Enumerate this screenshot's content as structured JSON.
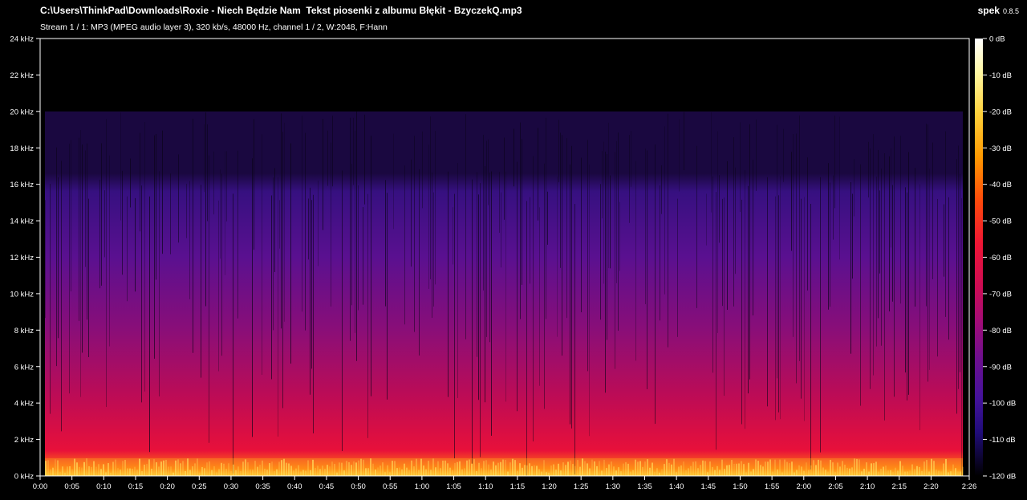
{
  "window": {
    "file_path": "C:\\Users\\ThinkPad\\Downloads\\Roxie - Niech Będzie Nam  Tekst piosenki z albumu Błękit - BzyczekQ.mp3",
    "stream_info": "Stream 1 / 1: MP3 (MPEG audio layer 3), 320 kb/s, 48000 Hz, channel 1 / 2, W:2048, F:Hann",
    "app_name": "spek",
    "app_version": "0.8.5"
  },
  "frequency_axis": {
    "ticks": [
      "0 kHz",
      "2 kHz",
      "4 kHz",
      "6 kHz",
      "8 kHz",
      "10 kHz",
      "12 kHz",
      "14 kHz",
      "16 kHz",
      "18 kHz",
      "20 kHz",
      "22 kHz",
      "24 kHz"
    ]
  },
  "time_axis": {
    "ticks": [
      "0:00",
      "0:05",
      "0:10",
      "0:15",
      "0:20",
      "0:25",
      "0:30",
      "0:35",
      "0:40",
      "0:45",
      "0:50",
      "0:55",
      "1:00",
      "1:05",
      "1:10",
      "1:15",
      "1:20",
      "1:25",
      "1:30",
      "1:35",
      "1:40",
      "1:45",
      "1:50",
      "1:55",
      "2:00",
      "2:05",
      "2:10",
      "2:15",
      "2:20",
      "2:26"
    ]
  },
  "db_scale": {
    "ticks": [
      "0 dB",
      "-10 dB",
      "-20 dB",
      "-30 dB",
      "-40 dB",
      "-50 dB",
      "-60 dB",
      "-70 dB",
      "-80 dB",
      "-90 dB",
      "-100 dB",
      "-110 dB",
      "-120 dB"
    ],
    "colors": [
      "#ffffff",
      "#fff9a0",
      "#ffd23c",
      "#ff9a00",
      "#ff4a0a",
      "#ef1535",
      "#cc0c55",
      "#a00c78",
      "#6e0f8e",
      "#45129c",
      "#200c7a",
      "#0a0640",
      "#000000"
    ]
  },
  "spectrogram": {
    "max_freq_khz": 24,
    "duration_s": 146,
    "cutoff_khz": 20
  }
}
